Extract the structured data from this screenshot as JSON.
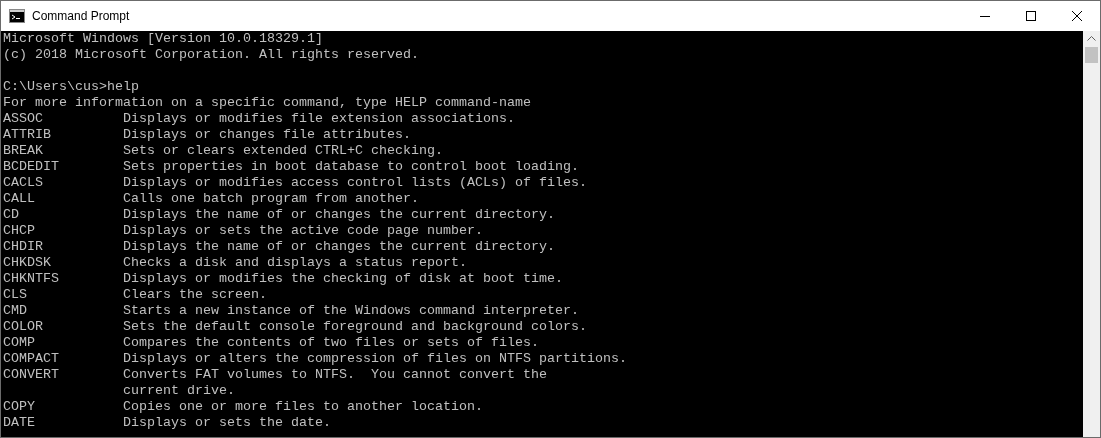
{
  "window": {
    "title": "Command Prompt"
  },
  "console": {
    "lines": [
      {
        "kind": "text",
        "text": "Microsoft Windows [Version 10.0.18329.1]"
      },
      {
        "kind": "text",
        "text": "(c) 2018 Microsoft Corporation. All rights reserved."
      },
      {
        "kind": "blank"
      },
      {
        "kind": "text",
        "text": "C:\\Users\\cus>help"
      },
      {
        "kind": "text",
        "text": "For more information on a specific command, type HELP command-name"
      },
      {
        "kind": "help",
        "command": "ASSOC",
        "description": "Displays or modifies file extension associations."
      },
      {
        "kind": "help",
        "command": "ATTRIB",
        "description": "Displays or changes file attributes."
      },
      {
        "kind": "help",
        "command": "BREAK",
        "description": "Sets or clears extended CTRL+C checking."
      },
      {
        "kind": "help",
        "command": "BCDEDIT",
        "description": "Sets properties in boot database to control boot loading."
      },
      {
        "kind": "help",
        "command": "CACLS",
        "description": "Displays or modifies access control lists (ACLs) of files."
      },
      {
        "kind": "help",
        "command": "CALL",
        "description": "Calls one batch program from another."
      },
      {
        "kind": "help",
        "command": "CD",
        "description": "Displays the name of or changes the current directory."
      },
      {
        "kind": "help",
        "command": "CHCP",
        "description": "Displays or sets the active code page number."
      },
      {
        "kind": "help",
        "command": "CHDIR",
        "description": "Displays the name of or changes the current directory."
      },
      {
        "kind": "help",
        "command": "CHKDSK",
        "description": "Checks a disk and displays a status report."
      },
      {
        "kind": "help",
        "command": "CHKNTFS",
        "description": "Displays or modifies the checking of disk at boot time."
      },
      {
        "kind": "help",
        "command": "CLS",
        "description": "Clears the screen."
      },
      {
        "kind": "help",
        "command": "CMD",
        "description": "Starts a new instance of the Windows command interpreter."
      },
      {
        "kind": "help",
        "command": "COLOR",
        "description": "Sets the default console foreground and background colors."
      },
      {
        "kind": "help",
        "command": "COMP",
        "description": "Compares the contents of two files or sets of files."
      },
      {
        "kind": "help",
        "command": "COMPACT",
        "description": "Displays or alters the compression of files on NTFS partitions."
      },
      {
        "kind": "help",
        "command": "CONVERT",
        "description": "Converts FAT volumes to NTFS.  You cannot convert the"
      },
      {
        "kind": "help",
        "description": "current drive."
      },
      {
        "kind": "help",
        "command": "COPY",
        "description": "Copies one or more files to another location."
      },
      {
        "kind": "help",
        "command": "DATE",
        "description": "Displays or sets the date."
      }
    ]
  }
}
